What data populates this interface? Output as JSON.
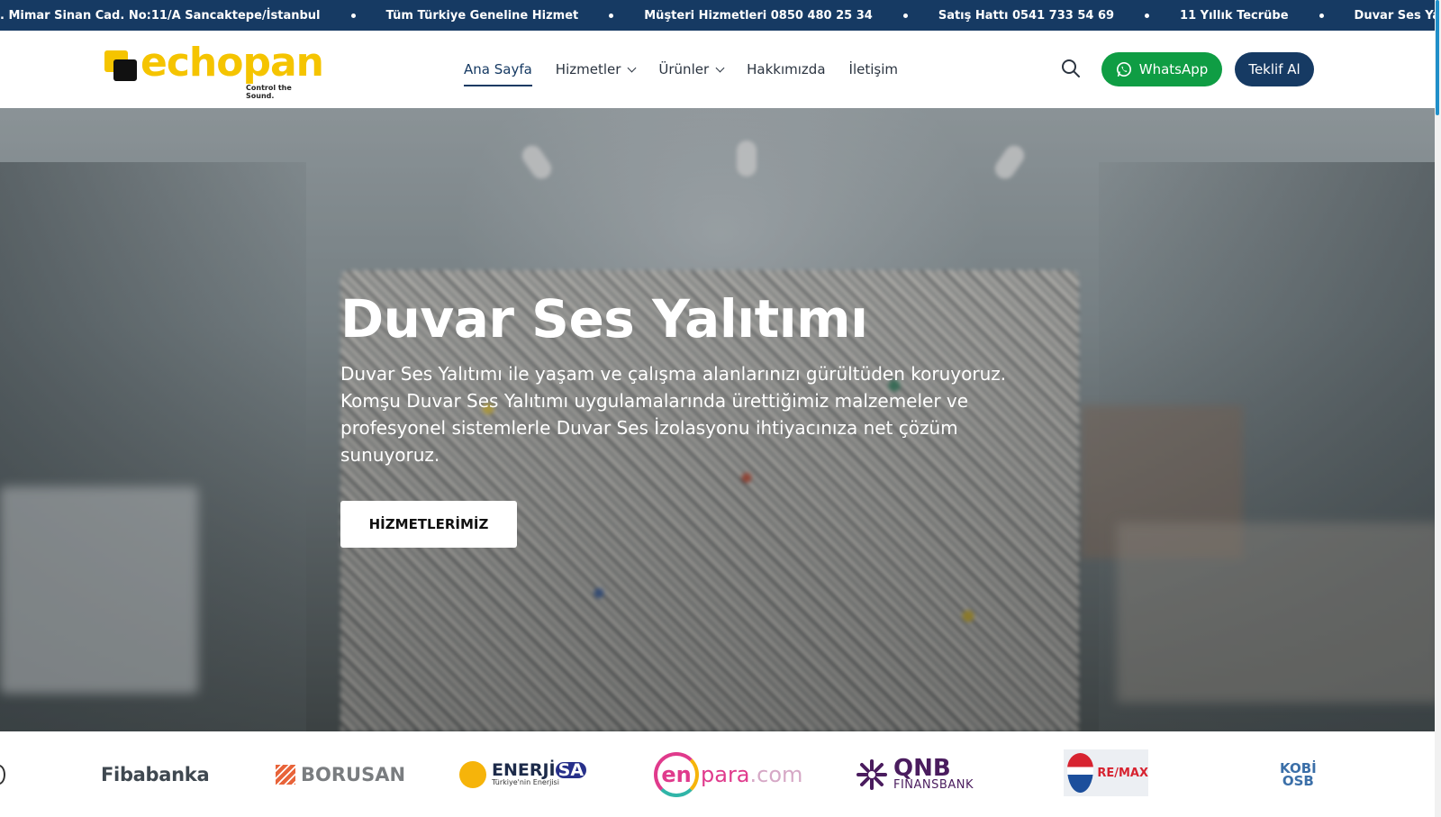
{
  "ticker": {
    "items": [
      ". Mimar Sinan Cad. No:11/A Sancaktepe/İstanbul",
      "Tüm Türkiye Geneline Hizmet",
      "Müşteri Hizmetleri 0850 480 25 34",
      "Satış Hattı 0541 733 54 69",
      "11 Yıllık Tecrübe",
      "Duvar Ses Yalıtımı Uygulaması"
    ]
  },
  "header": {
    "logo_text": "echopan",
    "logo_tagline": "Control the Sound.",
    "nav": [
      {
        "label": "Ana Sayfa",
        "active": true
      },
      {
        "label": "Hizmetler",
        "dropdown": true
      },
      {
        "label": "Ürünler",
        "dropdown": true
      },
      {
        "label": "Hakkımızda"
      },
      {
        "label": "İletişim"
      }
    ],
    "search_icon": "search-icon",
    "whatsapp_label": "WhatsApp",
    "quote_label": "Teklif Al",
    "colors": {
      "navy": "#163a63",
      "whatsapp_green": "#0f9d44",
      "brand_yellow": "#f5c400"
    }
  },
  "hero": {
    "title": "Duvar Ses Yalıtımı",
    "description": "Duvar Ses Yalıtımı ile yaşam ve çalışma alanlarınızı gürültüden koruyoruz. Komşu Duvar Ses Yalıtımı uygulamalarında ürettiğimiz malzemeler ve profesyonel sistemlerle Duvar Ses İzolasyonu ihtiyacınıza net çözüm sunuyoruz.",
    "button_label": "HİZMETLERİMİZ"
  },
  "partners": {
    "fibabanka": "Fibabanka",
    "borusan": "BORUSAN",
    "enerjisa_main": "ENERJİ",
    "enerjisa_sa": "SA",
    "enerjisa_sub": "Türkiye'nin Enerjisi",
    "enpara_en": "en",
    "enpara_para": "para",
    "enpara_com": ".com",
    "qnb_main": "QNB",
    "qnb_sub": "FINANSBANK",
    "remax": "RE/MAX",
    "kobi_top": "KOBİ",
    "kobi_bottom": "OSB"
  }
}
